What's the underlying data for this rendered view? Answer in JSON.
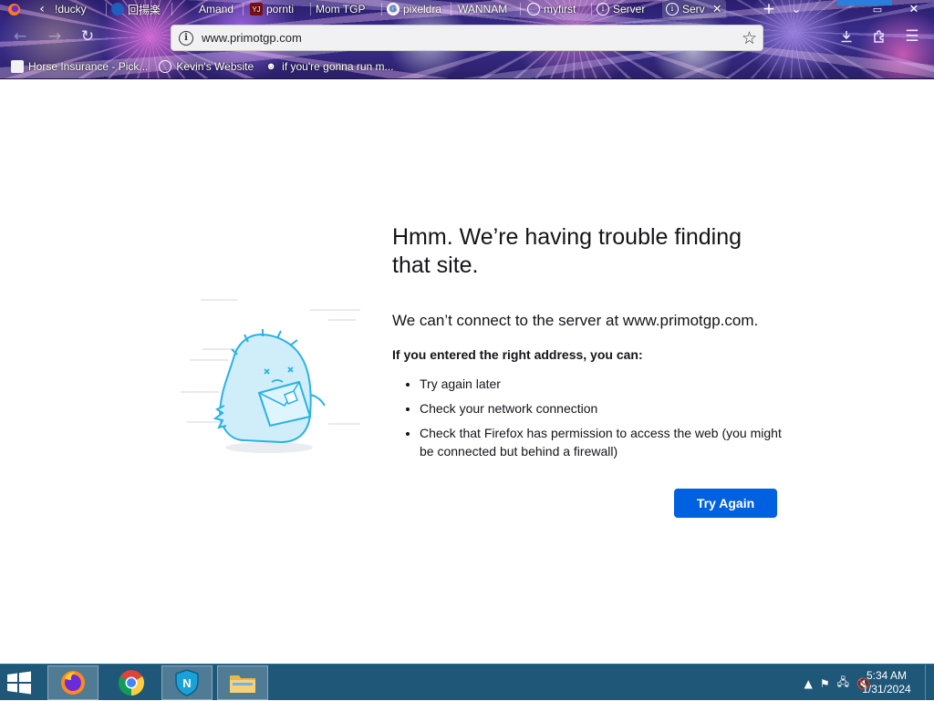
{
  "browser": {
    "tabs": [
      {
        "label": "!ducky",
        "icon": "firefox-icon",
        "active": false
      },
      {
        "label": "回揚楽",
        "icon": "blue-dot-icon",
        "active": false
      },
      {
        "label": "Amand",
        "icon": "",
        "active": false
      },
      {
        "label": "pornti",
        "icon": "yj-icon",
        "active": false
      },
      {
        "label": "Mom TGP",
        "icon": "page-icon",
        "active": false
      },
      {
        "label": "pixeldra",
        "icon": "google-icon",
        "active": false
      },
      {
        "label": "WANNAM",
        "icon": "",
        "active": false
      },
      {
        "label": "myfirst",
        "icon": "chrome-style-icon",
        "active": false
      },
      {
        "label": "Server",
        "icon": "info-icon",
        "active": false
      },
      {
        "label": "Serv",
        "icon": "info-icon",
        "active": true
      }
    ],
    "url": "www.primotgp.com",
    "bookmarks": [
      {
        "label": "Horse Insurance - Pick...",
        "icon": "page-icon"
      },
      {
        "label": "Kevin's Website",
        "icon": "globe-icon"
      },
      {
        "label": "if you're gonna run m...",
        "icon": "mask-icon"
      }
    ]
  },
  "error": {
    "title": "Hmm. We’re having trouble finding that site.",
    "description": "We can’t connect to the server at www.primotgp.com.",
    "intro": "If you entered the right address, you can:",
    "tips": [
      "Try again later",
      "Check your network connection",
      "Check that Firefox has permission to access the web (you might be connected but behind a firewall)"
    ],
    "button": "Try Again",
    "accent": "#0061e0"
  },
  "taskbar": {
    "apps": [
      "firefox",
      "chrome",
      "norton-shield",
      "file-explorer"
    ],
    "time": "5:34 AM",
    "date": "1/31/2024"
  }
}
